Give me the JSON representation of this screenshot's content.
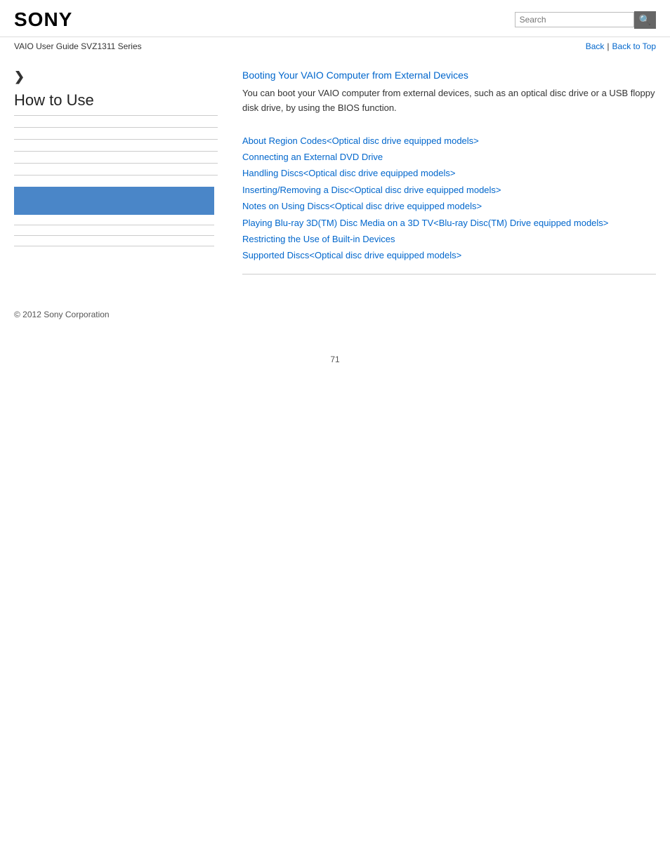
{
  "header": {
    "logo": "SONY",
    "search_placeholder": "Search"
  },
  "breadcrumb": {
    "guide_title": "VAIO User Guide SVZ1311 Series",
    "back_label": "Back",
    "back_to_top_label": "Back to Top",
    "separator": "|"
  },
  "sidebar": {
    "arrow": "❯",
    "section_title": "How to Use",
    "items": []
  },
  "content": {
    "main_link_title": "Booting Your VAIO Computer from External Devices",
    "main_description": "You can boot your VAIO computer from external devices, such as an optical disc drive or a USB floppy disk drive, by using the BIOS function.",
    "related_links": [
      "About Region Codes<Optical disc drive equipped models>",
      "Connecting an External DVD Drive",
      "Handling Discs<Optical disc drive equipped models>",
      "Inserting/Removing a Disc<Optical disc drive equipped models>",
      "Notes on Using Discs<Optical disc drive equipped models>",
      "Playing Blu-ray 3D(TM) Disc Media on a 3D TV<Blu-ray Disc(TM) Drive equipped models>",
      "Restricting the Use of Built-in Devices",
      "Supported Discs<Optical disc drive equipped models>"
    ]
  },
  "footer": {
    "copyright": "© 2012 Sony Corporation"
  },
  "page": {
    "number": "71"
  }
}
